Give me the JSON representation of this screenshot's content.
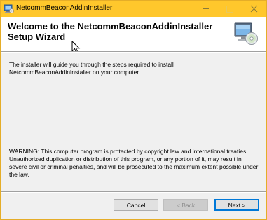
{
  "window": {
    "title": "NetcommBeaconAddinInstaller",
    "controls": {
      "minimize": "minimize-icon",
      "maximize": "maximize-icon",
      "close": "close-icon"
    },
    "title_bar_color": "#ffc72c"
  },
  "header": {
    "title": "Welcome to the NetcommBeaconAddinInstaller Setup Wizard",
    "icon": "computer-setup-icon"
  },
  "body": {
    "intro": "The installer will guide you through the steps required to install NetcommBeaconAddinInstaller on your computer.",
    "warning": "WARNING: This computer program is protected by copyright law and international treaties. Unauthorized duplication or distribution of this program, or any portion of it, may result in severe civil or criminal penalties, and will be prosecuted to the maximum extent possible under the law."
  },
  "buttons": {
    "cancel": "Cancel",
    "back": "< Back",
    "next": "Next >"
  }
}
